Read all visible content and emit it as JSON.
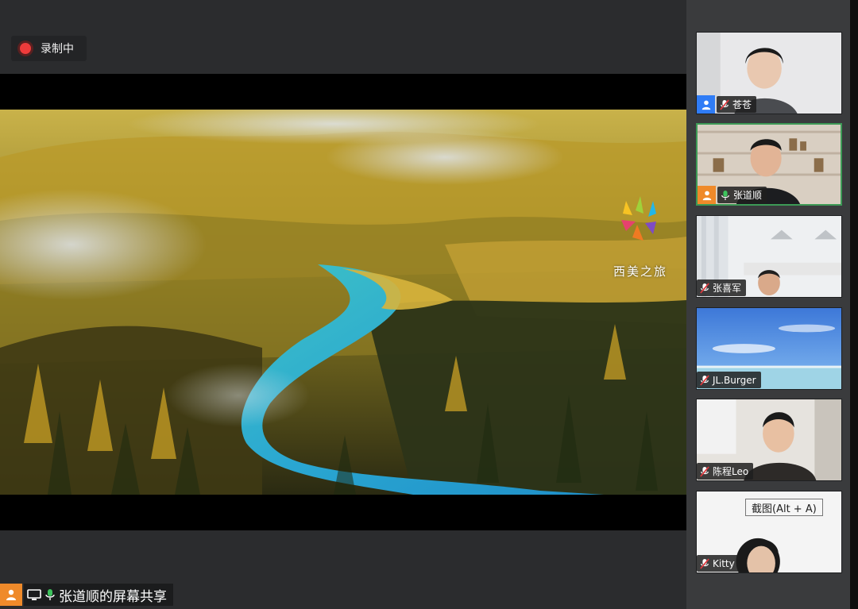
{
  "recording": {
    "label": "录制中",
    "status_color": "#ef3b3b"
  },
  "shared_screen": {
    "description_icon": "landscape-photo",
    "watermark_text": "西美之旅",
    "status_text": "张道顺的屏幕共享",
    "presenter_role_icon": "user-icon",
    "share_icon": "screen-share-icon",
    "mic_icon": "mic-on-icon"
  },
  "participants": [
    {
      "name": "苍苍",
      "mic": "muted",
      "host_icon": "user-icon",
      "host_color": "#2f7cf6",
      "active": false
    },
    {
      "name": "张道顺",
      "mic": "on",
      "host_icon": "user-icon",
      "host_color": "#ef8a2a",
      "active": true
    },
    {
      "name": "张喜军",
      "mic": "muted",
      "active": false
    },
    {
      "name": "JL.Burger",
      "mic": "muted",
      "active": false
    },
    {
      "name": "陈程Leo",
      "mic": "muted",
      "active": false
    },
    {
      "name": "Kitty",
      "mic": "muted",
      "active": false
    }
  ],
  "tooltip": {
    "text": "截图(Alt + A)"
  },
  "colors": {
    "accent_green": "#3d9a56",
    "muted_red": "#e0393e",
    "background": "#2b2c2e"
  }
}
